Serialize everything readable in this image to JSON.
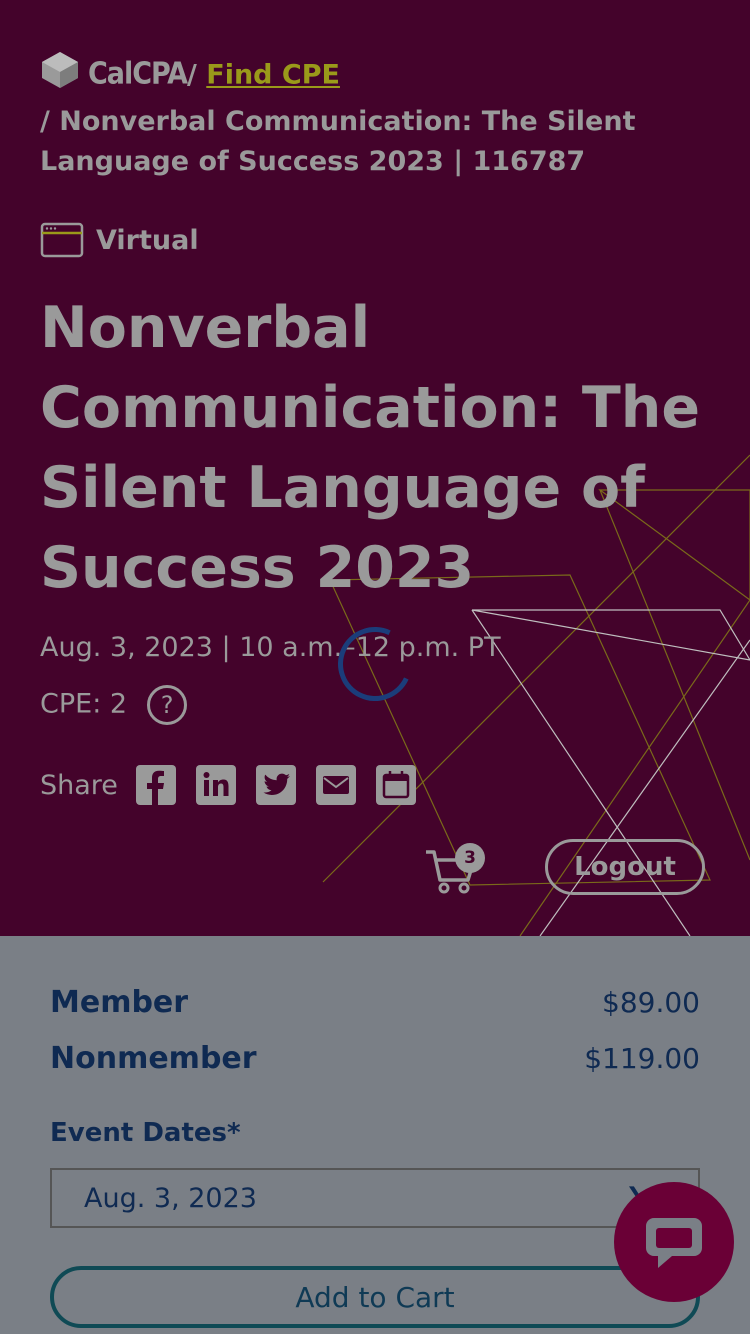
{
  "breadcrumb": {
    "brand": "CalCPA",
    "separator": "/",
    "link": "Find CPE",
    "current": "/ Nonverbal Communication: The Silent Language of Success 2023 | 116787"
  },
  "event": {
    "format": "Virtual",
    "title": "Nonverbal Communication: The Silent Language of Success 2023",
    "datetime": "Aug. 3, 2023 | 10 a.m.–12 p.m. PT",
    "cpe_label": "CPE: 2",
    "cpe_help": "?"
  },
  "share": {
    "label": "Share",
    "icons": [
      "facebook-icon",
      "linkedin-icon",
      "twitter-icon",
      "email-icon",
      "calendar-icon"
    ]
  },
  "header": {
    "cart_count": "3",
    "logout_label": "Logout"
  },
  "pricing": {
    "member_label": "Member",
    "member_price": "$89.00",
    "nonmember_label": "Nonmember",
    "nonmember_price": "$119.00"
  },
  "form": {
    "event_dates_label": "Event Dates*",
    "event_date_selected": "Aug. 3, 2023",
    "add_to_cart_label": "Add to Cart"
  },
  "colors": {
    "hero_bg": "#44032b",
    "overlay_text": "#9a9a9a",
    "link_accent": "#9a9a1a",
    "body_bg": "#7a7f86",
    "navy": "#0f2a52",
    "chat_bg": "#6a0036"
  }
}
